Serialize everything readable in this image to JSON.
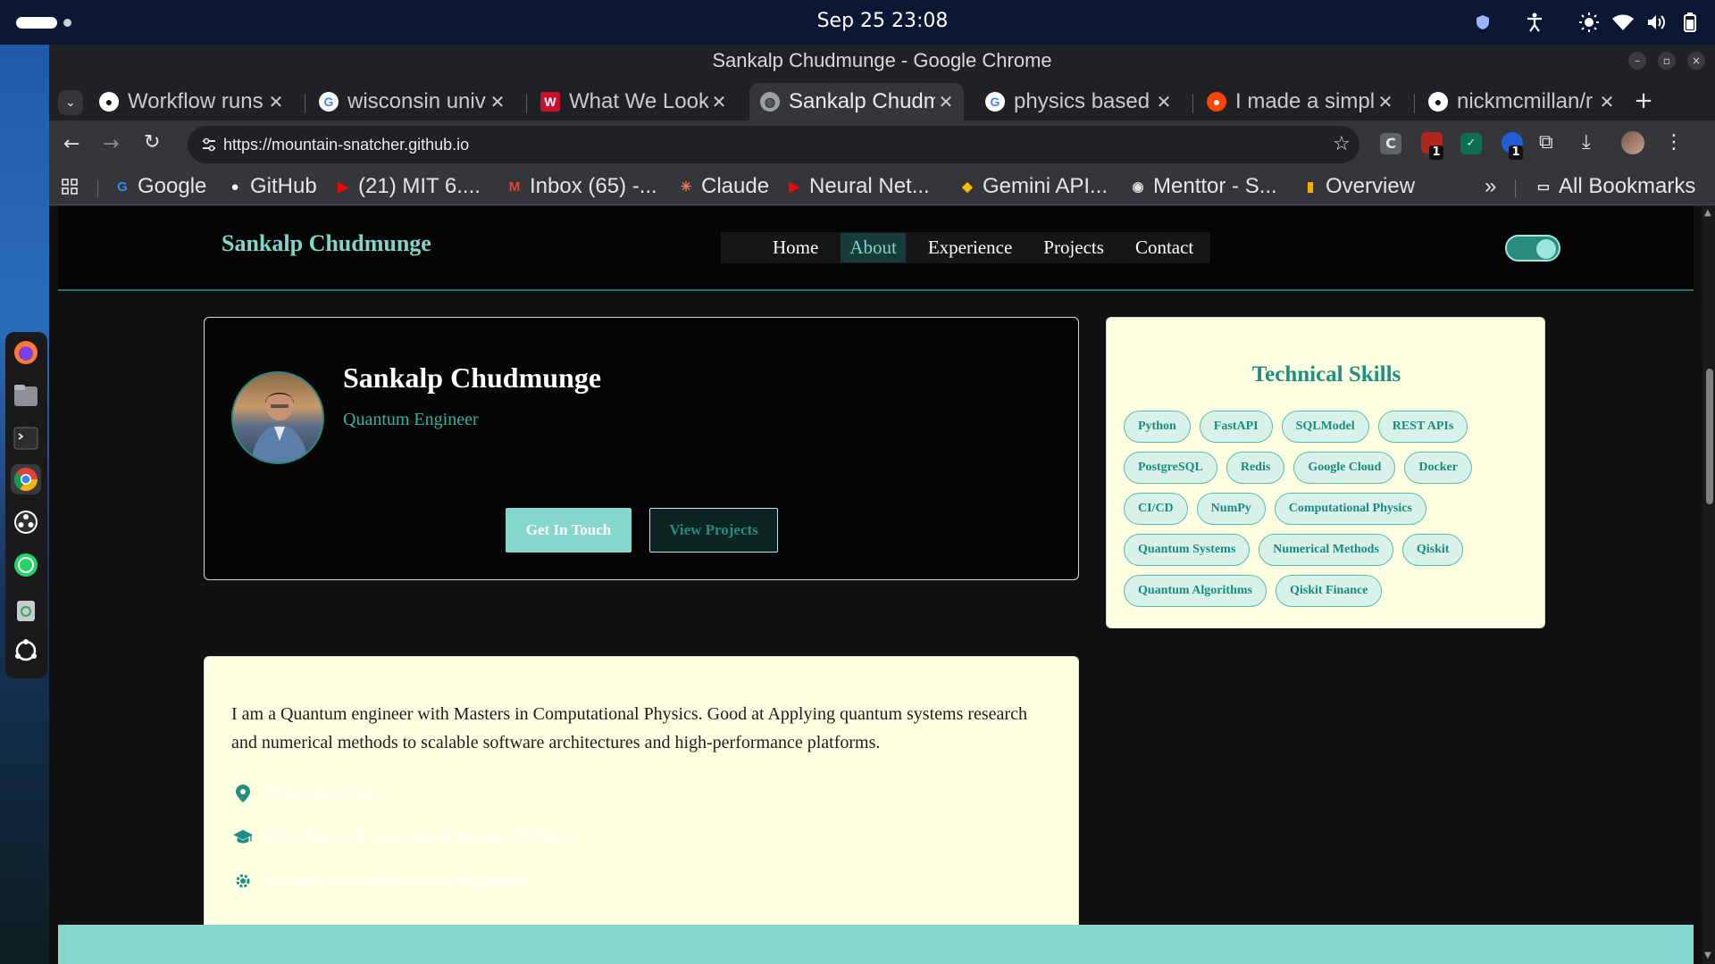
{
  "system": {
    "clock": "Sep 25  23:08"
  },
  "window": {
    "title": "Sankalp Chudmunge - Google Chrome"
  },
  "tabs": [
    {
      "title": "Workflow runs",
      "icon": "github-icon"
    },
    {
      "title": "wisconsin univ",
      "icon": "google-icon"
    },
    {
      "title": "What We Look",
      "icon": "w-logo-icon"
    },
    {
      "title": "Sankalp Chudm",
      "icon": "globe-icon",
      "active": true
    },
    {
      "title": "physics based",
      "icon": "google-icon"
    },
    {
      "title": "I made a simpl",
      "icon": "reddit-icon"
    },
    {
      "title": "nickmcmillan/r",
      "icon": "github-icon"
    }
  ],
  "address_bar": {
    "url": "https://mountain-snatcher.github.io"
  },
  "bookmarks": [
    {
      "label": "Google",
      "icon": "google-icon"
    },
    {
      "label": "GitHub",
      "icon": "github-icon"
    },
    {
      "label": "(21) MIT 6....",
      "icon": "youtube-icon"
    },
    {
      "label": "Inbox (65) -...",
      "icon": "gmail-icon"
    },
    {
      "label": "Claude",
      "icon": "claude-icon"
    },
    {
      "label": "Neural Net...",
      "icon": "youtube-icon"
    },
    {
      "label": "Gemini API...",
      "icon": "gemini-icon"
    },
    {
      "label": "Menttor - S...",
      "icon": "menttor-icon"
    },
    {
      "label": "Overview",
      "icon": "analytics-icon"
    }
  ],
  "bookmarks_overflow": "»",
  "all_bookmarks": "All Bookmarks",
  "extension_badges": [
    "1",
    "1"
  ],
  "site": {
    "brand": "Sankalp Chudmunge",
    "nav": [
      "Home",
      "About",
      "Experience",
      "Projects",
      "Contact"
    ],
    "active_nav": "About",
    "theme_toggle_on": true,
    "profile": {
      "name": "Sankalp Chudmunge",
      "role": "Quantum Engineer",
      "cta_primary": "Get In Touch",
      "cta_secondary": "View Projects"
    },
    "about": {
      "text": "I am a Quantum engineer with Masters in Computational Physics. Good at Applying quantum systems research and numerical methods to scalable software architectures and high-performance platforms.",
      "details": [
        {
          "icon": "location-pin-icon",
          "text": "Maharashtra, India"
        },
        {
          "icon": "graduation-cap-icon",
          "text": "M.Sc. Physics (Computational Physics), IIT Bhilai"
        },
        {
          "icon": "atom-gear-icon",
          "text": "Quantum Systems & Quantum Engineering"
        }
      ]
    },
    "skills": {
      "title": "Technical Skills",
      "items": [
        "Python",
        "FastAPI",
        "SQLModel",
        "REST APIs",
        "PostgreSQL",
        "Redis",
        "Google Cloud",
        "Docker",
        "CI/CD",
        "NumPy",
        "Computational Physics",
        "Quantum Systems",
        "Numerical Methods",
        "Qiskit",
        "Quantum Algorithms",
        "Qiskit Finance"
      ]
    }
  },
  "colors": {
    "accent": "#2fb3a2",
    "accent_light": "#86d8cf",
    "card_light": "#ffffe2",
    "page_bg": "#111111"
  }
}
